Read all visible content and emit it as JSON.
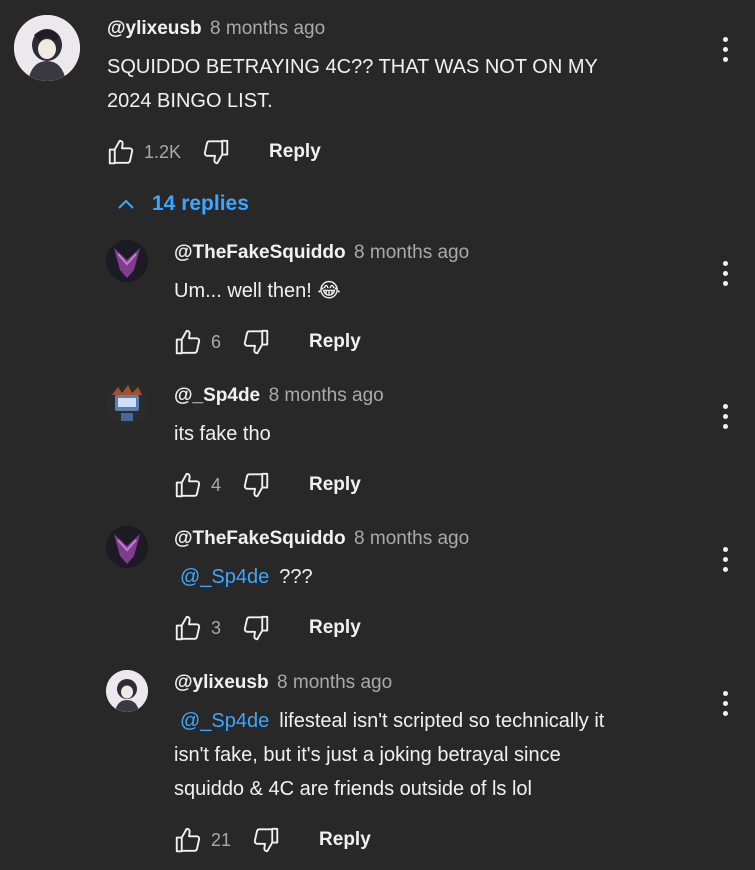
{
  "top_comment": {
    "author": "@ylixeusb",
    "time": "8 months ago",
    "text_line1": "SQUIDDO BETRAYING 4C??  THAT WAS NOT ON MY",
    "text_line2": "2024 BINGO LIST.",
    "likes": "1.2K",
    "reply_label": "Reply"
  },
  "replies_toggle": {
    "label": "14 replies",
    "icon": "chevron-up-icon"
  },
  "replies": [
    {
      "author": "@TheFakeSquiddo",
      "time": "8 months ago",
      "text": "Um... well then! 😂",
      "likes": "6",
      "reply_label": "Reply"
    },
    {
      "author": "@_Sp4de",
      "time": "8 months ago",
      "text": "its fake tho",
      "likes": "4",
      "reply_label": "Reply"
    },
    {
      "author": "@TheFakeSquiddo",
      "time": "8 months ago",
      "mention": "@_Sp4de",
      "text": "???",
      "likes": "3",
      "reply_label": "Reply"
    },
    {
      "author": "@ylixeusb",
      "time": "8 months ago",
      "mention": "@_Sp4de",
      "text_line1": "lifesteal isn't scripted so technically it",
      "text_line2": "isn't fake, but it's just a joking betrayal since",
      "text_line3": "squiddo & 4C are friends outside of ls lol",
      "likes": "21",
      "reply_label": "Reply"
    }
  ],
  "colors": {
    "background": "#282828",
    "text": "#f1f1f1",
    "secondary": "#aaaaaa",
    "link": "#3ea6ff"
  },
  "icons": [
    "like-icon",
    "dislike-icon",
    "more-vert-icon",
    "chevron-up-icon"
  ]
}
